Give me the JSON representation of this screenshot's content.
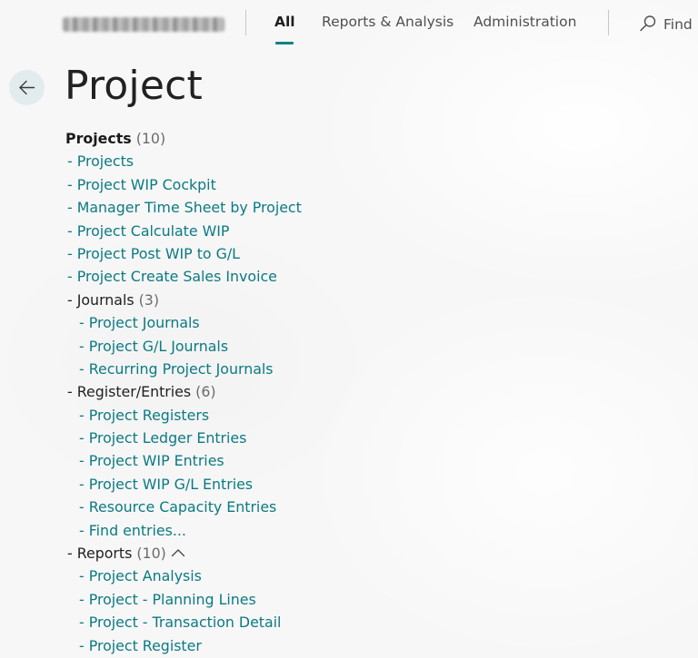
{
  "nav": {
    "tabs": [
      {
        "label": "All",
        "active": true
      },
      {
        "label": "Reports & Analysis",
        "active": false
      },
      {
        "label": "Administration",
        "active": false
      }
    ],
    "find_label": "Find",
    "accent_color": "#00838a"
  },
  "page": {
    "title": "Project",
    "back_icon": "arrow-left-icon"
  },
  "tree": {
    "section": {
      "label": "Projects",
      "count": "(10)"
    },
    "links": [
      "Projects",
      "Project WIP Cockpit",
      "Manager Time Sheet by Project",
      "Project Calculate WIP",
      "Project Post WIP to G/L",
      "Project Create Sales Invoice"
    ],
    "groups": {
      "journals": {
        "label": "Journals",
        "count": "(3)",
        "items": [
          "Project Journals",
          "Project G/L Journals",
          "Recurring Project Journals"
        ]
      },
      "register": {
        "label": "Register/Entries",
        "count": "(6)",
        "items": [
          "Project Registers",
          "Project Ledger Entries",
          "Project WIP Entries",
          "Project WIP G/L Entries",
          "Resource Capacity Entries",
          "Find entries..."
        ]
      },
      "reports": {
        "label": "Reports",
        "count": "(10)",
        "expanded": true,
        "items": [
          "Project Analysis",
          "Project - Planning Lines",
          "Project - Transaction Detail",
          "Project Register"
        ]
      }
    },
    "link_color": "#0b7a82"
  }
}
